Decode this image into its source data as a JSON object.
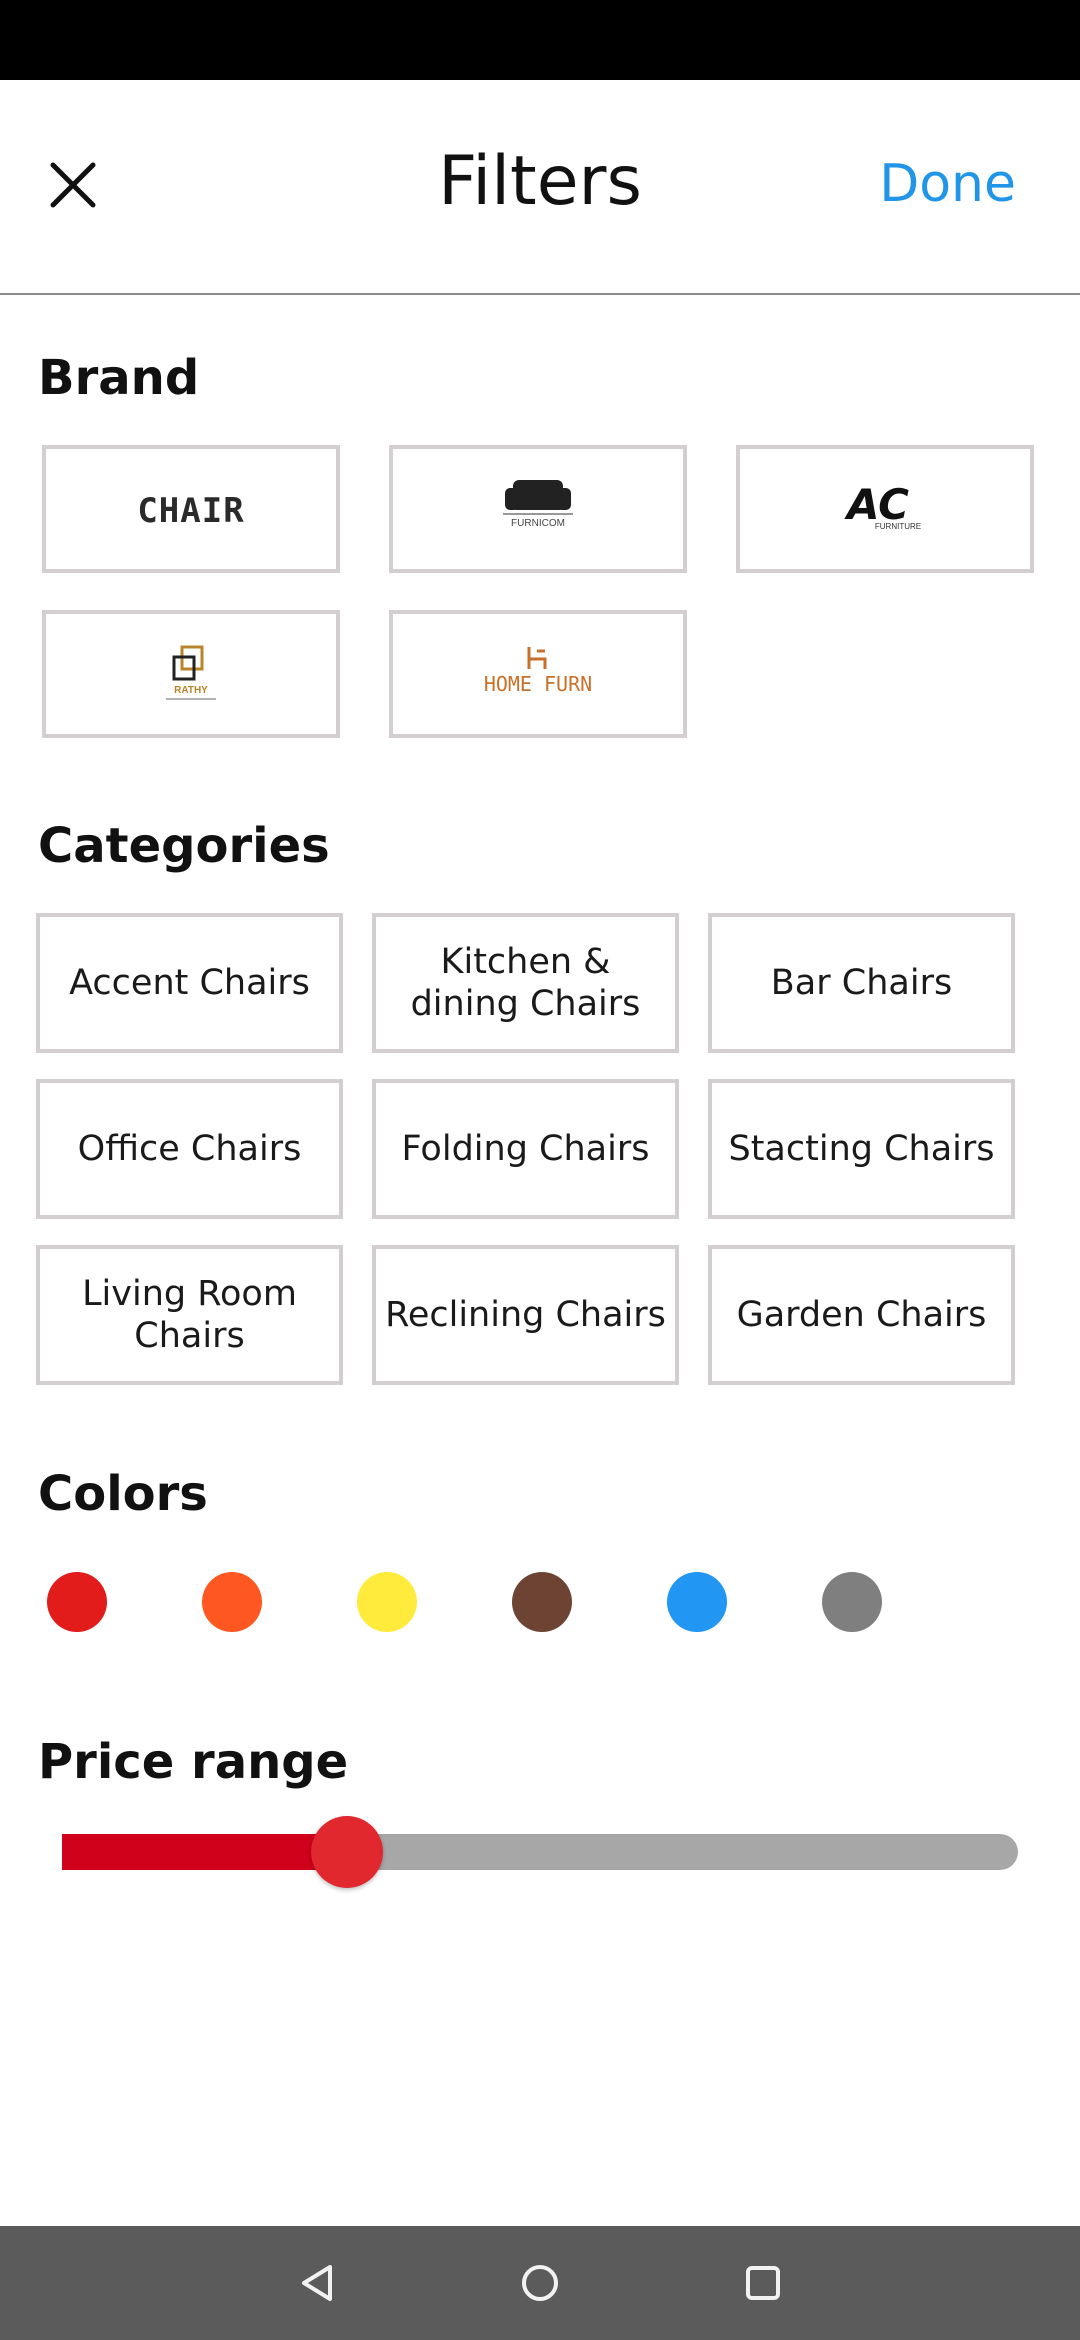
{
  "header": {
    "title": "Filters",
    "done_label": "Done",
    "close_icon": "close-icon"
  },
  "brand": {
    "title": "Brand",
    "logos": [
      {
        "text": "CHAIR",
        "icon": "chair-brand-logo"
      },
      {
        "text": "FURNICOM",
        "icon": "sofa-brand-logo"
      },
      {
        "text": "AC",
        "subtext": "FURNITURE",
        "icon": "ac-furniture-logo"
      },
      {
        "text": "RATHY",
        "icon": "rathy-brand-logo"
      },
      {
        "text": "HOME FURN",
        "icon": "home-furn-logo"
      }
    ]
  },
  "categories": {
    "title": "Categories",
    "items": [
      "Accent Chairs",
      "Kitchen & dining Chairs",
      "Bar Chairs",
      "Office Chairs",
      "Folding Chairs",
      "Stacting Chairs",
      "Living Room Chairs",
      "Reclining Chairs",
      "Garden Chairs"
    ]
  },
  "colors": {
    "title": "Colors",
    "swatches": [
      "#e21b1b",
      "#ff5722",
      "#ffeb3b",
      "#6d4434",
      "#2196f3",
      "#7f7f7f"
    ]
  },
  "price_range": {
    "title": "Price range",
    "value_fraction": 0.3,
    "fill_color": "#d0021b",
    "thumb_color": "#e0282e"
  },
  "nav": {
    "back_icon": "back-triangle-icon",
    "home_icon": "home-circle-icon",
    "recents_icon": "recents-square-icon"
  }
}
